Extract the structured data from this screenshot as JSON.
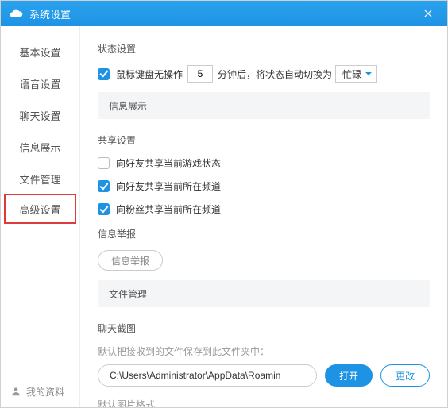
{
  "titlebar": {
    "title": "系统设置"
  },
  "sidebar": {
    "items": [
      {
        "label": "基本设置"
      },
      {
        "label": "语音设置"
      },
      {
        "label": "聊天设置"
      },
      {
        "label": "信息展示"
      },
      {
        "label": "文件管理"
      },
      {
        "label": "高级设置"
      }
    ],
    "profile_label": "我的资料"
  },
  "status": {
    "section": "状态设置",
    "cb1_label_before": "鼠标键盘无操作",
    "idle_value": "5",
    "cb1_label_mid": "分钟后，将状态自动切换为",
    "select_value": "忙碌"
  },
  "subhead_info": "信息展示",
  "share": {
    "section": "共享设置",
    "opt1": "向好友共享当前游戏状态",
    "opt2": "向好友共享当前所在频道",
    "opt3": "向粉丝共享当前所在频道"
  },
  "report": {
    "section": "信息举报",
    "btn": "信息举报"
  },
  "subhead_file": "文件管理",
  "screenshot": {
    "section": "聊天截图",
    "hint": "默认把接收到的文件保存到此文件夹中：",
    "path": "C:\\Users\\Administrator\\AppData\\Roamin",
    "open": "打开",
    "change": "更改",
    "bottom": "默认图片格式"
  }
}
